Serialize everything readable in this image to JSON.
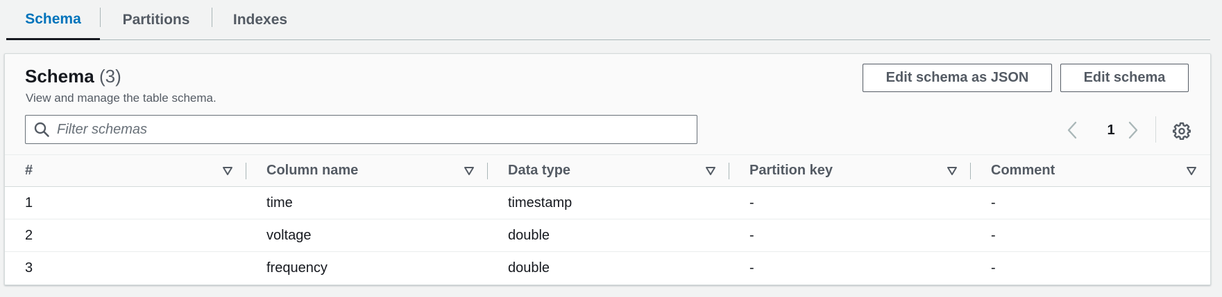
{
  "tabs": [
    {
      "label": "Schema",
      "active": true
    },
    {
      "label": "Partitions",
      "active": false
    },
    {
      "label": "Indexes",
      "active": false
    }
  ],
  "card": {
    "title": "Schema",
    "count": "(3)",
    "description": "View and manage the table schema.",
    "edit_json_label": "Edit schema as JSON",
    "edit_label": "Edit schema"
  },
  "filter": {
    "placeholder": "Filter schemas",
    "value": ""
  },
  "pagination": {
    "current_page": "1"
  },
  "icons": {
    "search": "search-icon",
    "prev": "chevron-left-icon",
    "next": "chevron-right-icon",
    "settings": "gear-icon",
    "sort": "caret-down-icon"
  },
  "colors": {
    "active_tab": "#0073bb",
    "text": "#16191f",
    "secondary_text": "#545b64",
    "background": "#f2f3f3"
  },
  "table": {
    "columns": [
      "#",
      "Column name",
      "Data type",
      "Partition key",
      "Comment"
    ],
    "rows": [
      [
        "1",
        "time",
        "timestamp",
        "-",
        "-"
      ],
      [
        "2",
        "voltage",
        "double",
        "-",
        "-"
      ],
      [
        "3",
        "frequency",
        "double",
        "-",
        "-"
      ]
    ]
  }
}
